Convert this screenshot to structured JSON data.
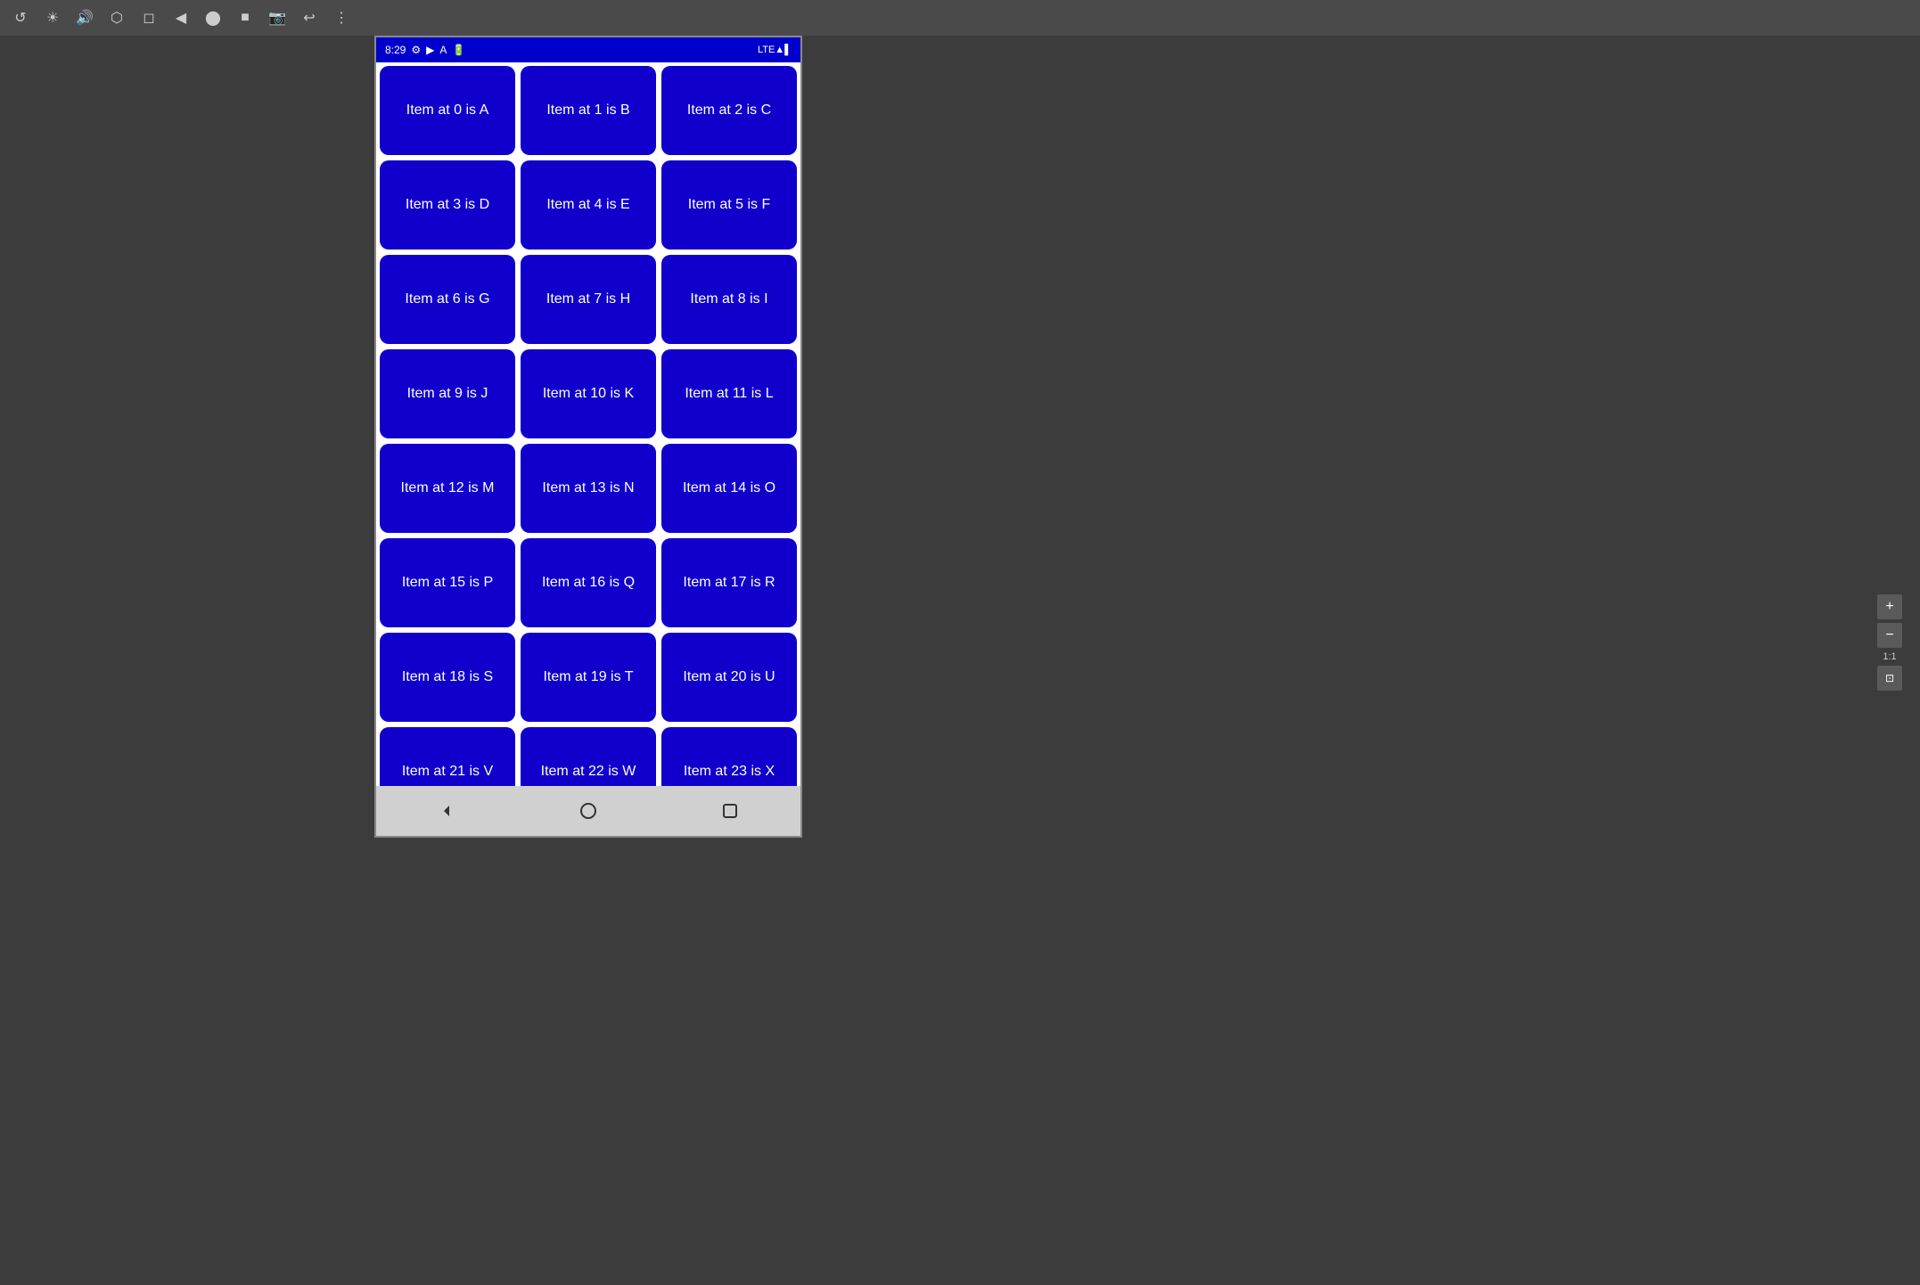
{
  "toolbar": {
    "icons": [
      "↺",
      "☀",
      "🔊",
      "⬡",
      "◻",
      "◀",
      "⬤",
      "■",
      "📷",
      "↩",
      "⋮"
    ]
  },
  "statusBar": {
    "time": "8:29",
    "rightIcons": "LTE▲▌"
  },
  "items": [
    {
      "index": 0,
      "letter": "A",
      "label": "Item at 0 is A"
    },
    {
      "index": 1,
      "letter": "B",
      "label": "Item at 1 is B"
    },
    {
      "index": 2,
      "letter": "C",
      "label": "Item at 2 is C"
    },
    {
      "index": 3,
      "letter": "D",
      "label": "Item at 3 is D"
    },
    {
      "index": 4,
      "letter": "E",
      "label": "Item at 4 is E"
    },
    {
      "index": 5,
      "letter": "F",
      "label": "Item at 5 is F"
    },
    {
      "index": 6,
      "letter": "G",
      "label": "Item at 6 is G"
    },
    {
      "index": 7,
      "letter": "H",
      "label": "Item at 7 is H"
    },
    {
      "index": 8,
      "letter": "I",
      "label": "Item at 8 is I"
    },
    {
      "index": 9,
      "letter": "J",
      "label": "Item at 9 is J"
    },
    {
      "index": 10,
      "letter": "K",
      "label": "Item at 10 is K"
    },
    {
      "index": 11,
      "letter": "L",
      "label": "Item at 11 is L"
    },
    {
      "index": 12,
      "letter": "M",
      "label": "Item at 12 is M"
    },
    {
      "index": 13,
      "letter": "N",
      "label": "Item at 13 is N"
    },
    {
      "index": 14,
      "letter": "O",
      "label": "Item at 14 is O"
    },
    {
      "index": 15,
      "letter": "P",
      "label": "Item at 15 is P"
    },
    {
      "index": 16,
      "letter": "Q",
      "label": "Item at 16 is Q"
    },
    {
      "index": 17,
      "letter": "R",
      "label": "Item at 17 is R"
    },
    {
      "index": 18,
      "letter": "S",
      "label": "Item at 18 is S"
    },
    {
      "index": 19,
      "letter": "T",
      "label": "Item at 19 is T"
    },
    {
      "index": 20,
      "letter": "U",
      "label": "Item at 20 is U"
    },
    {
      "index": 21,
      "letter": "V",
      "label": "Item at 21 is V"
    },
    {
      "index": 22,
      "letter": "W",
      "label": "Item at 22 is W"
    },
    {
      "index": 23,
      "letter": "X",
      "label": "Item at 23 is X"
    }
  ],
  "navBar": {
    "backLabel": "◀",
    "homeLabel": "⬤",
    "recentLabel": "■"
  },
  "zoom": {
    "plus": "+",
    "minus": "−",
    "label": "1:1",
    "fit": "⊡"
  }
}
